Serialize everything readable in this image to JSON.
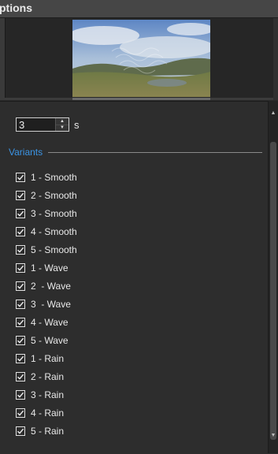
{
  "window": {
    "title": "ptions"
  },
  "preview": {
    "image_name": "landscape-thumbnail"
  },
  "duration": {
    "value": "3",
    "unit": "s"
  },
  "variants": {
    "title": "Variants",
    "items": [
      {
        "label": "1 - Smooth",
        "checked": true
      },
      {
        "label": "2 - Smooth",
        "checked": true
      },
      {
        "label": "3 - Smooth",
        "checked": true
      },
      {
        "label": "4 - Smooth",
        "checked": true
      },
      {
        "label": "5 - Smooth",
        "checked": true
      },
      {
        "label": "1 - Wave",
        "checked": true
      },
      {
        "label": "2  - Wave",
        "checked": true
      },
      {
        "label": "3  - Wave",
        "checked": true
      },
      {
        "label": "4 - Wave",
        "checked": true
      },
      {
        "label": "5 - Wave",
        "checked": true
      },
      {
        "label": "1 - Rain",
        "checked": true
      },
      {
        "label": "2 - Rain",
        "checked": true
      },
      {
        "label": "3 - Rain",
        "checked": true
      },
      {
        "label": "4 - Rain",
        "checked": true
      },
      {
        "label": "5 - Rain",
        "checked": true
      }
    ]
  },
  "colors": {
    "accent": "#3b95e6",
    "panel": "#2d2d2d"
  }
}
